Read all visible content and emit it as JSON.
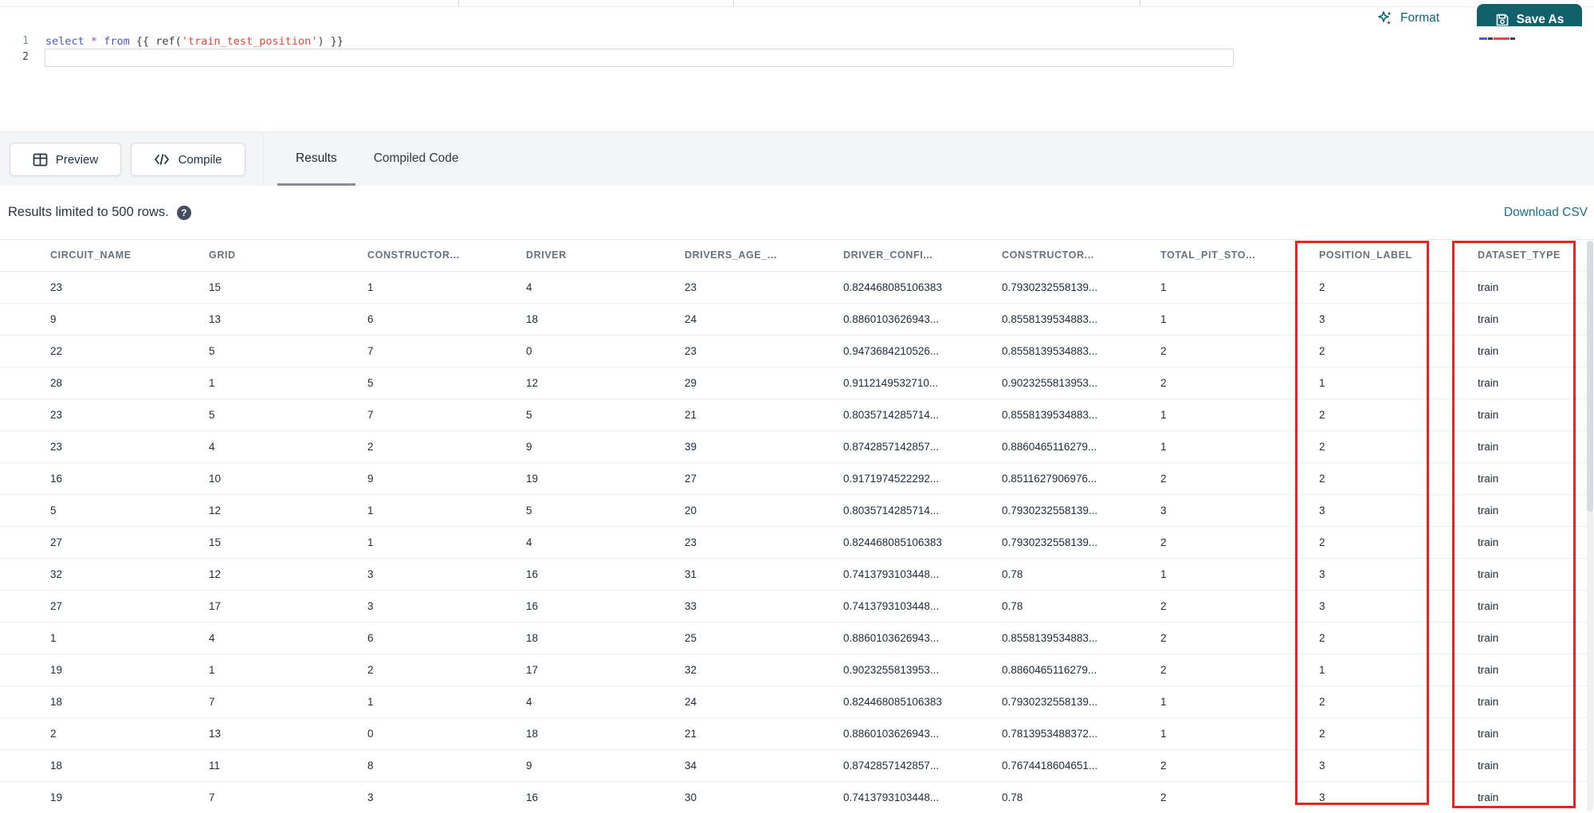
{
  "editor": {
    "line_numbers": [
      "1",
      "2"
    ],
    "code_tokens": [
      {
        "type": "keyword",
        "text": "select"
      },
      {
        "type": "plain",
        "text": " "
      },
      {
        "type": "operator",
        "text": "*"
      },
      {
        "type": "plain",
        "text": " "
      },
      {
        "type": "keyword",
        "text": "from"
      },
      {
        "type": "plain",
        "text": " {{ ref("
      },
      {
        "type": "string",
        "text": "'train_test_position'"
      },
      {
        "type": "plain",
        "text": ") }}"
      }
    ]
  },
  "header_bar": {
    "format_label": "Format",
    "save_as_label": "Save As"
  },
  "toolbar": {
    "preview_label": "Preview",
    "compile_label": "Compile",
    "tabs": [
      {
        "label": "Results",
        "active": true
      },
      {
        "label": "Compiled Code",
        "active": false
      }
    ]
  },
  "results_bar": {
    "notice": "Results limited to 500 rows.",
    "help_icon": "?",
    "download_label": "Download CSV"
  },
  "table": {
    "columns": [
      "CIRCUIT_NAME",
      "GRID",
      "CONSTRUCTOR...",
      "DRIVER",
      "DRIVERS_AGE_...",
      "DRIVER_CONFI...",
      "CONSTRUCTOR...",
      "TOTAL_PIT_STO...",
      "POSITION_LABEL",
      "DATASET_TYPE"
    ],
    "rows": [
      [
        "23",
        "15",
        "1",
        "4",
        "23",
        "0.824468085106383",
        "0.7930232558139...",
        "1",
        "2",
        "train"
      ],
      [
        "9",
        "13",
        "6",
        "18",
        "24",
        "0.8860103626943...",
        "0.8558139534883...",
        "1",
        "3",
        "train"
      ],
      [
        "22",
        "5",
        "7",
        "0",
        "23",
        "0.9473684210526...",
        "0.8558139534883...",
        "2",
        "2",
        "train"
      ],
      [
        "28",
        "1",
        "5",
        "12",
        "29",
        "0.9112149532710...",
        "0.9023255813953...",
        "2",
        "1",
        "train"
      ],
      [
        "23",
        "5",
        "7",
        "5",
        "21",
        "0.8035714285714...",
        "0.8558139534883...",
        "1",
        "2",
        "train"
      ],
      [
        "23",
        "4",
        "2",
        "9",
        "39",
        "0.8742857142857...",
        "0.8860465116279...",
        "1",
        "2",
        "train"
      ],
      [
        "16",
        "10",
        "9",
        "19",
        "27",
        "0.9171974522292...",
        "0.8511627906976...",
        "2",
        "2",
        "train"
      ],
      [
        "5",
        "12",
        "1",
        "5",
        "20",
        "0.8035714285714...",
        "0.7930232558139...",
        "3",
        "3",
        "train"
      ],
      [
        "27",
        "15",
        "1",
        "4",
        "23",
        "0.824468085106383",
        "0.7930232558139...",
        "2",
        "2",
        "train"
      ],
      [
        "32",
        "12",
        "3",
        "16",
        "31",
        "0.7413793103448...",
        "0.78",
        "1",
        "3",
        "train"
      ],
      [
        "27",
        "17",
        "3",
        "16",
        "33",
        "0.7413793103448...",
        "0.78",
        "2",
        "3",
        "train"
      ],
      [
        "1",
        "4",
        "6",
        "18",
        "25",
        "0.8860103626943...",
        "0.8558139534883...",
        "2",
        "2",
        "train"
      ],
      [
        "19",
        "1",
        "2",
        "17",
        "32",
        "0.9023255813953...",
        "0.8860465116279...",
        "2",
        "1",
        "train"
      ],
      [
        "18",
        "7",
        "1",
        "4",
        "24",
        "0.824468085106383",
        "0.7930232558139...",
        "1",
        "2",
        "train"
      ],
      [
        "2",
        "13",
        "0",
        "18",
        "21",
        "0.8860103626943...",
        "0.7813953488372...",
        "1",
        "2",
        "train"
      ],
      [
        "18",
        "11",
        "8",
        "9",
        "34",
        "0.8742857142857...",
        "0.7674418604651...",
        "2",
        "3",
        "train"
      ],
      [
        "19",
        "7",
        "3",
        "16",
        "30",
        "0.7413793103448...",
        "0.78",
        "2",
        "3",
        "train"
      ]
    ],
    "highlighted_columns": [
      "POSITION_LABEL",
      "DATASET_TYPE"
    ]
  },
  "colors": {
    "accent_teal": "#11616b",
    "link_teal": "#16708a",
    "highlight_red": "#e8241f"
  }
}
